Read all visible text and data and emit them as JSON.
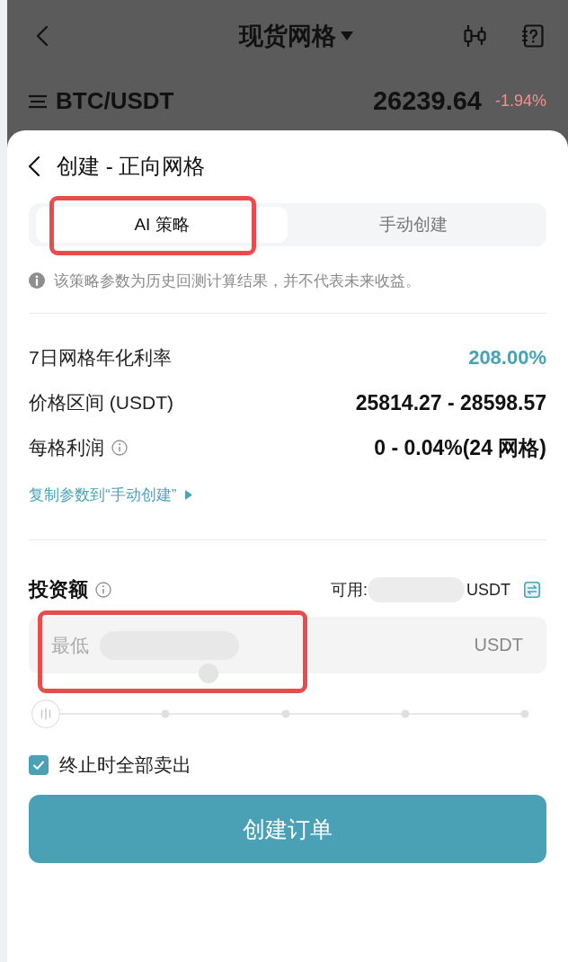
{
  "header": {
    "title": "现货网格"
  },
  "ticker": {
    "pair": "BTC/USDT",
    "price": "26239.64",
    "change": "-1.94%"
  },
  "sheet": {
    "title": "创建 - 正向网格",
    "tabs": [
      {
        "label": "AI 策略",
        "selected": true,
        "highlighted": true
      },
      {
        "label": "手动创建",
        "selected": false,
        "highlighted": false
      }
    ],
    "notice": "该策略参数为历史回测计算结果，并不代表未来收益。",
    "stats": [
      {
        "label": "7日网格年化利率",
        "value": "208.00%",
        "kind": "accent",
        "info": false
      },
      {
        "label": "价格区间 (USDT)",
        "value": "25814.27 - 28598.57",
        "kind": "plain",
        "info": false
      },
      {
        "label": "每格利润",
        "value": "0 - 0.04%(24 网格)",
        "kind": "plain",
        "info": true
      }
    ],
    "copy_link": "复制参数到“手动创建”",
    "investment": {
      "label": "投资额",
      "info": true,
      "available": {
        "label": "可用:",
        "redacted": true,
        "unit": "USDT"
      },
      "amount": {
        "placeholder": "最低",
        "redacted": true,
        "unit": "USDT",
        "highlighted": true
      },
      "slider": {
        "level": 0
      }
    },
    "sell_all": {
      "label": "终止时全部卖出",
      "checked": true
    },
    "submit": "创建订单"
  }
}
